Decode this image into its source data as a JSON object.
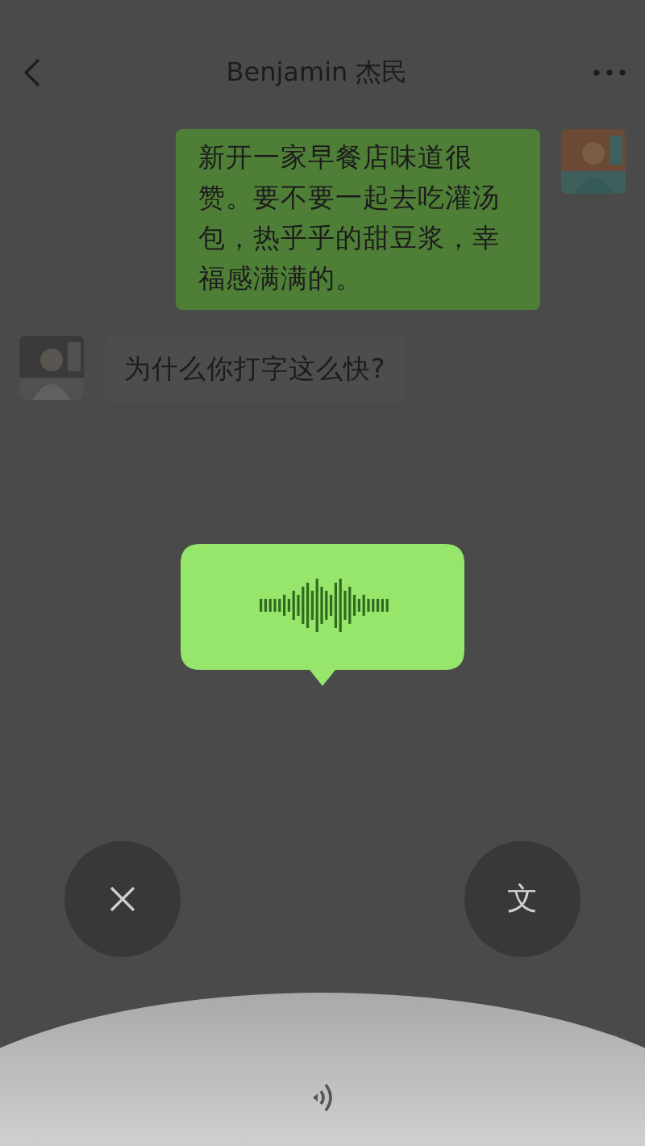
{
  "header": {
    "title": "Benjamin 杰民"
  },
  "messages": [
    {
      "kind": "sent",
      "text": "新开一家早餐店味道很赞。要不要一起去吃灌汤包，热乎乎的甜豆浆，幸福感满满的。"
    },
    {
      "kind": "received",
      "text": "为什么你打字这么快?"
    }
  ],
  "voice_controls": {
    "convert_label": "文"
  }
}
